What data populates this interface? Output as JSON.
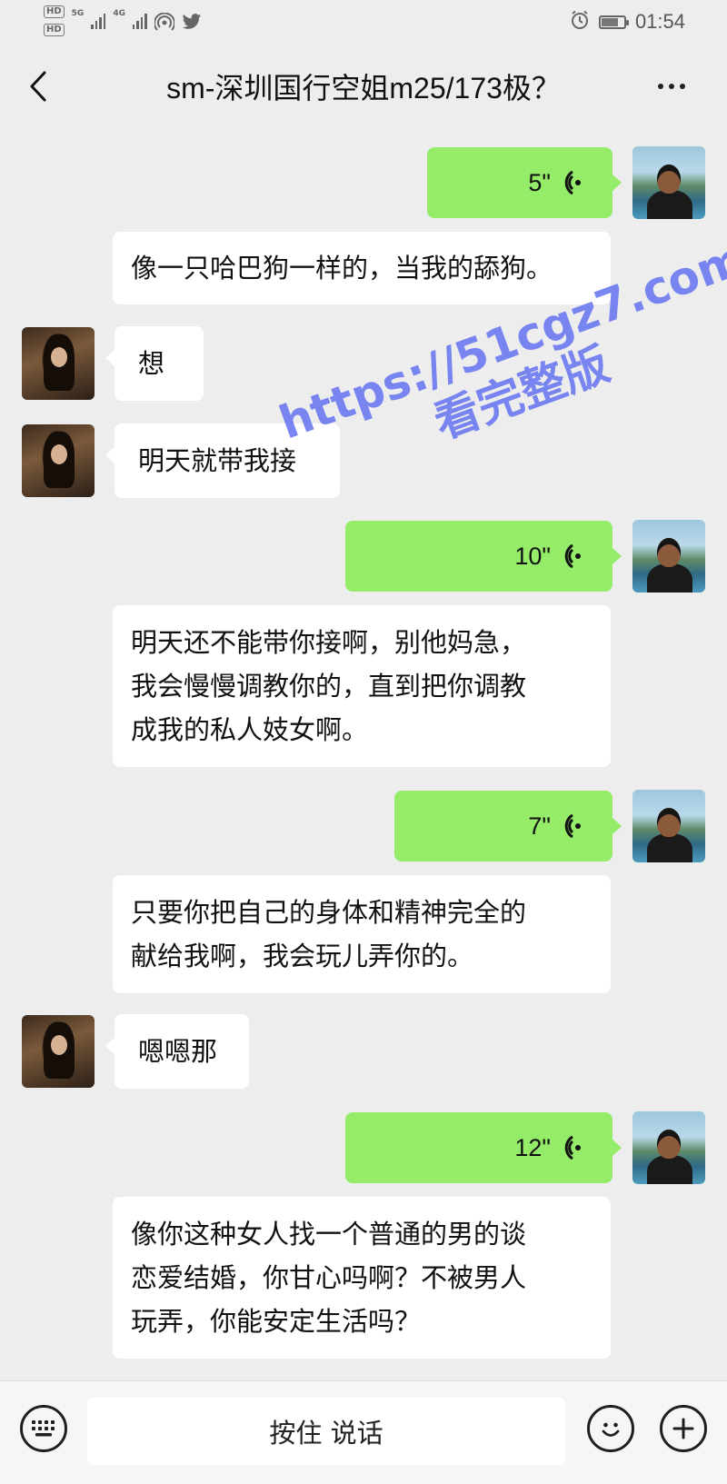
{
  "status_bar": {
    "hd1": "HD",
    "hd2": "HD",
    "net1": "5G",
    "net2": "4G",
    "time": "01:54"
  },
  "header": {
    "title": "sm-深圳国行空姐m25/173极？"
  },
  "messages": [
    {
      "sender": "self",
      "type": "voice",
      "duration": "5\""
    },
    {
      "sender": "self",
      "type": "text",
      "text": "像一只哈巴狗一样的，当我的舔狗。"
    },
    {
      "sender": "other",
      "type": "text",
      "text": "想"
    },
    {
      "sender": "other",
      "type": "text",
      "text": "明天就带我接"
    },
    {
      "sender": "self",
      "type": "voice",
      "duration": "10\""
    },
    {
      "sender": "self",
      "type": "text",
      "lines": [
        "明天还不能带你接啊，别他妈急，",
        "我会慢慢调教你的，直到把你调教",
        "成我的私人妓女啊。"
      ]
    },
    {
      "sender": "self",
      "type": "voice",
      "duration": "7\""
    },
    {
      "sender": "self",
      "type": "text",
      "lines": [
        "只要你把自己的身体和精神完全的",
        "献给我啊，我会玩儿弄你的。"
      ]
    },
    {
      "sender": "other",
      "type": "text",
      "text": "嗯嗯那"
    },
    {
      "sender": "self",
      "type": "voice",
      "duration": "12\""
    },
    {
      "sender": "self",
      "type": "text",
      "lines": [
        "像你这种女人找一个普通的男的谈",
        "恋爱结婚，你甘心吗啊？不被男人",
        "玩弄，你能安定生活吗？"
      ]
    }
  ],
  "watermark": {
    "url": "https://51cgz7.com",
    "text": "看完整版"
  },
  "input_bar": {
    "hold_to_talk": "按住 说话"
  },
  "icons": {
    "back": "chevron-left-icon",
    "more": "more-dots-icon",
    "voice_wave": "voice-wave-icon",
    "keyboard": "keyboard-icon",
    "emoji": "emoji-icon",
    "plus": "plus-icon"
  },
  "colors": {
    "background": "#ededed",
    "self_bubble": "#95ec69",
    "other_bubble": "#ffffff",
    "watermark": "#6f7cf0"
  }
}
